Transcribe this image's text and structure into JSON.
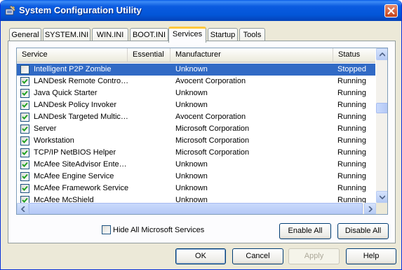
{
  "window": {
    "title": "System Configuration Utility"
  },
  "tabs": [
    {
      "label": "General"
    },
    {
      "label": "SYSTEM.INI"
    },
    {
      "label": "WIN.INI"
    },
    {
      "label": "BOOT.INI"
    },
    {
      "label": "Services"
    },
    {
      "label": "Startup"
    },
    {
      "label": "Tools"
    }
  ],
  "active_tab": "Services",
  "list": {
    "columns": {
      "service": "Service",
      "essential": "Essential",
      "manufacturer": "Manufacturer",
      "status": "Status"
    },
    "rows": [
      {
        "checked": false,
        "selected": true,
        "service": "Intelligent P2P Zombie",
        "essential": "",
        "manufacturer": "Unknown",
        "status": "Stopped"
      },
      {
        "checked": true,
        "selected": false,
        "service": "LANDesk Remote Contro…",
        "essential": "",
        "manufacturer": "Avocent Corporation",
        "status": "Running"
      },
      {
        "checked": true,
        "selected": false,
        "service": "Java Quick Starter",
        "essential": "",
        "manufacturer": "Unknown",
        "status": "Running"
      },
      {
        "checked": true,
        "selected": false,
        "service": "LANDesk Policy Invoker",
        "essential": "",
        "manufacturer": "Unknown",
        "status": "Running"
      },
      {
        "checked": true,
        "selected": false,
        "service": "LANDesk Targeted Multic…",
        "essential": "",
        "manufacturer": "Avocent Corporation",
        "status": "Running"
      },
      {
        "checked": true,
        "selected": false,
        "service": "Server",
        "essential": "",
        "manufacturer": "Microsoft Corporation",
        "status": "Running"
      },
      {
        "checked": true,
        "selected": false,
        "service": "Workstation",
        "essential": "",
        "manufacturer": "Microsoft Corporation",
        "status": "Running"
      },
      {
        "checked": true,
        "selected": false,
        "service": "TCP/IP NetBIOS Helper",
        "essential": "",
        "manufacturer": "Microsoft Corporation",
        "status": "Running"
      },
      {
        "checked": true,
        "selected": false,
        "service": "McAfee SiteAdvisor Ente…",
        "essential": "",
        "manufacturer": "Unknown",
        "status": "Running"
      },
      {
        "checked": true,
        "selected": false,
        "service": "McAfee Engine Service",
        "essential": "",
        "manufacturer": "Unknown",
        "status": "Running"
      },
      {
        "checked": true,
        "selected": false,
        "service": "McAfee Framework Service",
        "essential": "",
        "manufacturer": "Unknown",
        "status": "Running"
      },
      {
        "checked": true,
        "selected": false,
        "service": "McAfee McShield",
        "essential": "",
        "manufacturer": "Unknown",
        "status": "Running"
      }
    ]
  },
  "options": {
    "hide_microsoft_label": "Hide All Microsoft Services",
    "hide_microsoft_checked": false
  },
  "buttons": {
    "enable_all": "Enable All",
    "disable_all": "Disable All",
    "ok": "OK",
    "cancel": "Cancel",
    "apply": "Apply",
    "help": "Help"
  },
  "colors": {
    "titlebar": "#0356D8",
    "selection": "#316AC5",
    "close_button": "#C6431A",
    "active_tab_accent": "#FFC83C"
  },
  "icons": [
    "system-config-icon",
    "close-icon",
    "check-icon",
    "scroll-up-icon",
    "scroll-down-icon",
    "scroll-left-icon",
    "scroll-right-icon"
  ]
}
